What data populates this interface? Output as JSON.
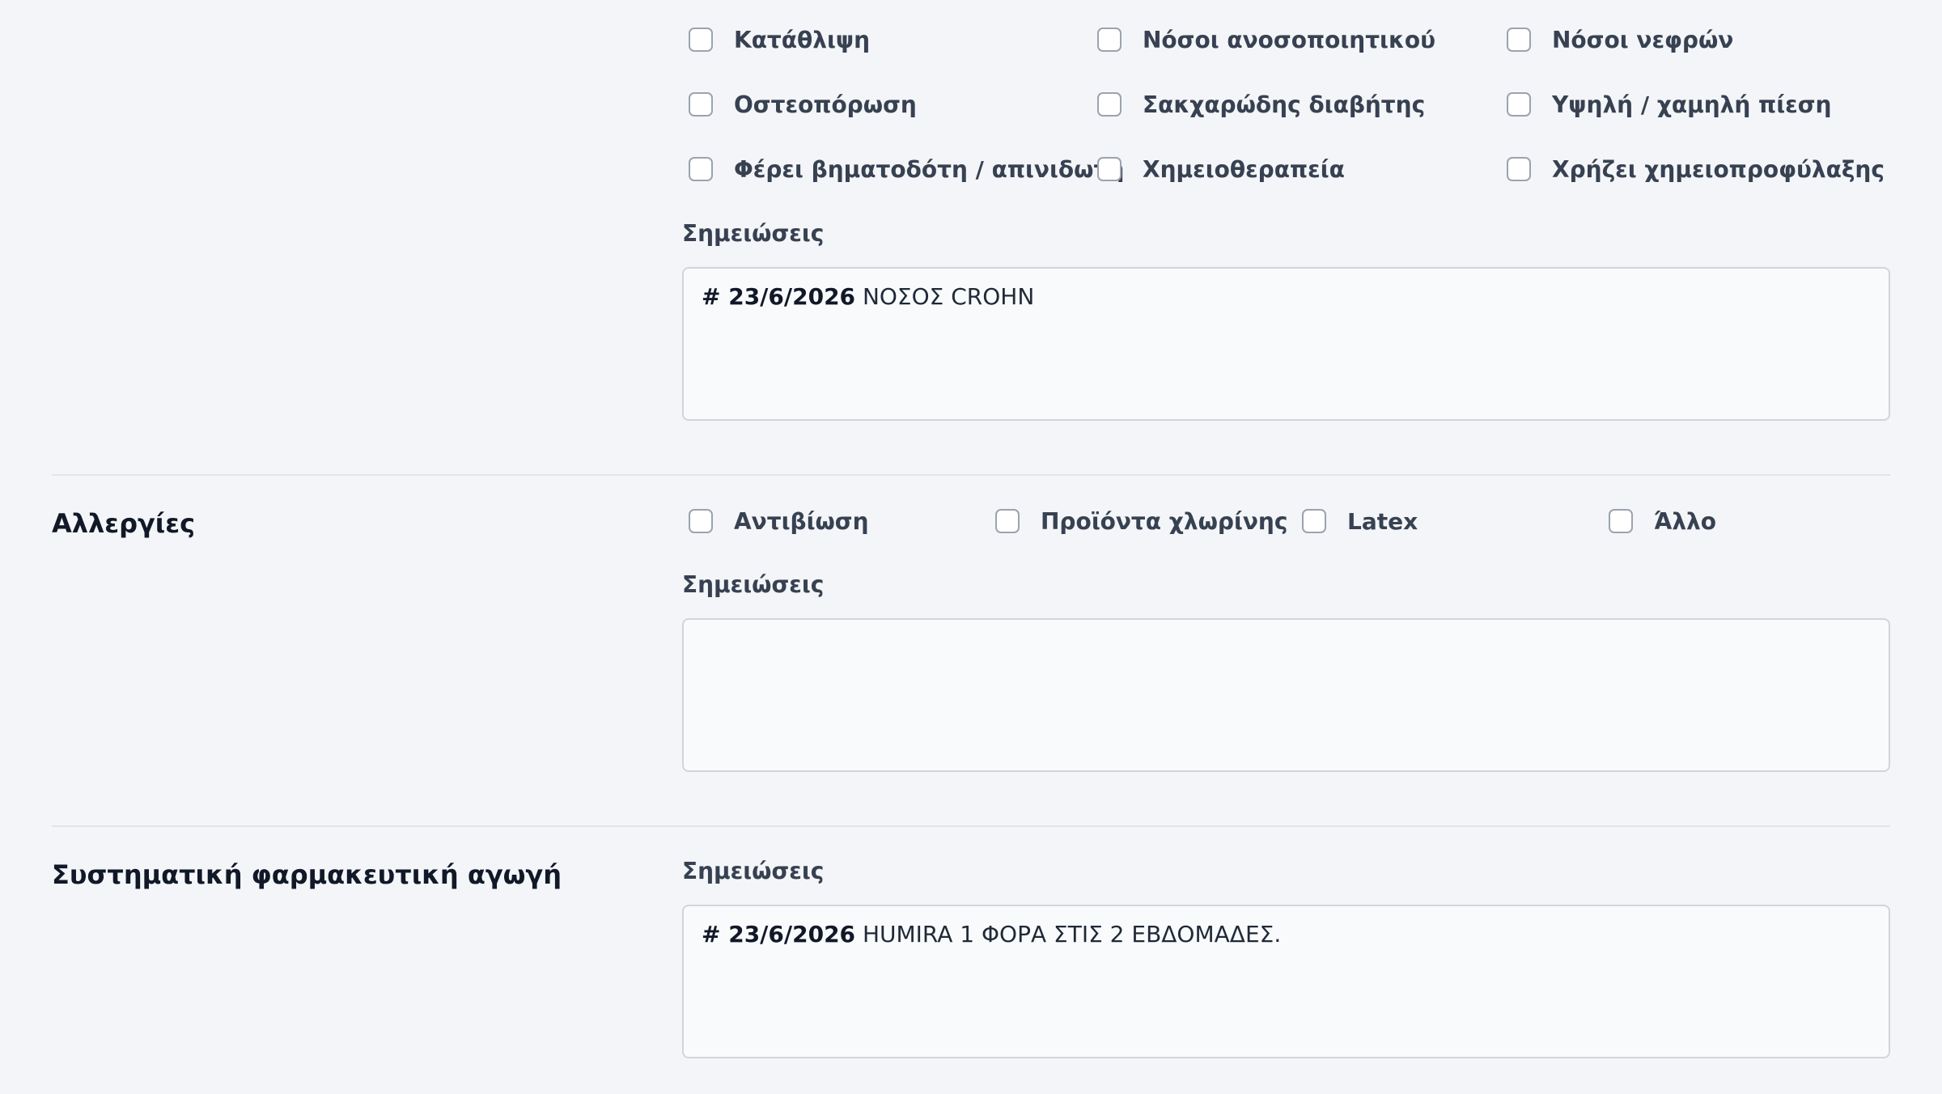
{
  "conditions": {
    "rows": [
      [
        "Κατάθλιψη",
        "Νόσοι ανοσοποιητικού",
        "Νόσοι νεφρών"
      ],
      [
        "Οστεοπόρωση",
        "Σακχαρώδης διαβήτης",
        "Υψηλή / χαμηλή πίεση"
      ],
      [
        "Φέρει βηματοδότη / απινιδωτή",
        "Χημειοθεραπεία",
        "Χρήζει χημειοπροφύλαξης"
      ]
    ],
    "notes_label": "Σημειώσεις",
    "notes_date": "# 23/6/2026",
    "notes_text": " ΝΟΣΟΣ CROHN"
  },
  "allergies": {
    "title": "Αλλεργίες",
    "options": [
      "Αντιβίωση",
      "Προϊόντα χλωρίνης",
      "Latex",
      "Άλλο"
    ],
    "notes_label": "Σημειώσεις",
    "notes_text": ""
  },
  "medication": {
    "title": "Συστηματική φαρμακευτική αγωγή",
    "notes_label": "Σημειώσεις",
    "notes_date": "# 23/6/2026",
    "notes_text": " HUMIRA 1 ΦΟΡΑ ΣΤΙΣ 2 ΕΒΔΟΜΑΔΕΣ."
  }
}
